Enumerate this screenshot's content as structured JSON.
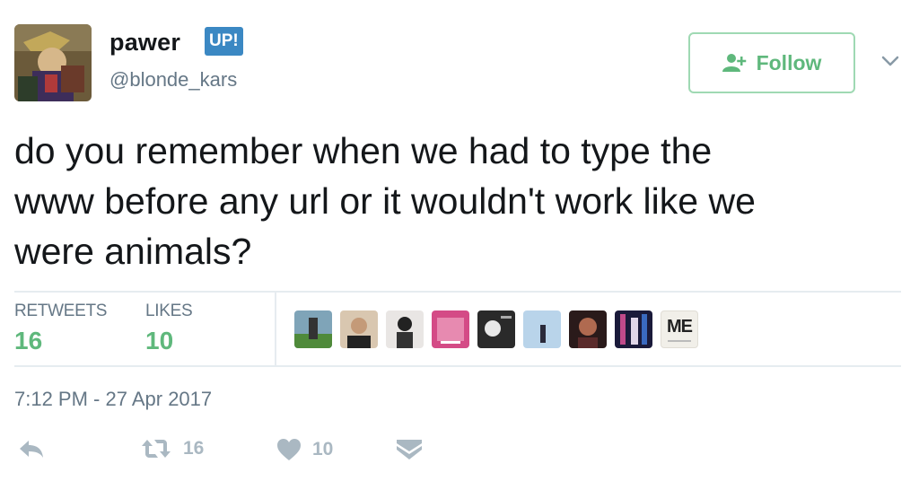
{
  "user": {
    "display_name": "pawer",
    "badge": "UP!",
    "handle": "@blonde_kars"
  },
  "follow_button": {
    "label": "Follow"
  },
  "tweet": {
    "line1": "do you remember when we had to type the",
    "line2": "www before any url or it wouldn't work like we",
    "line3": "were animals?"
  },
  "stats": {
    "retweets_label": "RETWEETS",
    "retweets_value": "16",
    "likes_label": "LIKES",
    "likes_value": "10"
  },
  "likers": {
    "me_label": "ME"
  },
  "timestamp": "7:12 PM - 27 Apr 2017",
  "actions": {
    "retweet_count": "16",
    "like_count": "10"
  },
  "colors": {
    "follow_green": "#5fb87c",
    "muted_gray": "#657786",
    "icon_gray": "#aab8c2",
    "badge_blue": "#3b88c3"
  },
  "icons": [
    "follow-person-icon",
    "chevron-down-icon",
    "reply-icon",
    "retweet-icon",
    "heart-icon",
    "direct-message-icon"
  ]
}
